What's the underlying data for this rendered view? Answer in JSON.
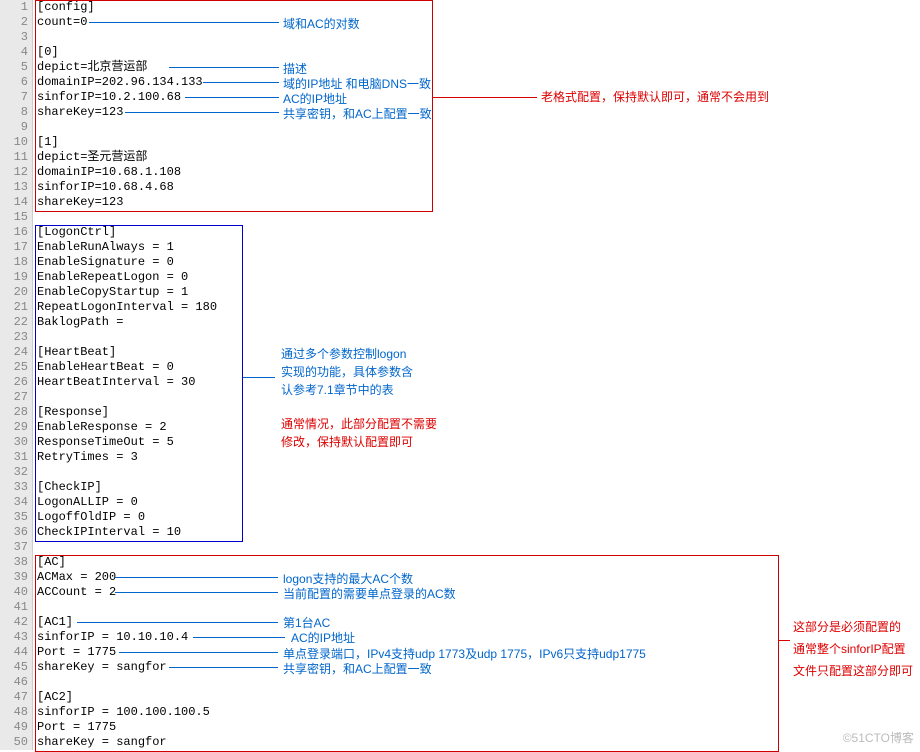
{
  "lines": [
    "[config]",
    "count=0",
    "",
    "[0]",
    "depict=北京营运部",
    "domainIP=202.96.134.133",
    "sinforIP=10.2.100.68",
    "shareKey=123",
    "",
    "[1]",
    "depict=圣元营运部",
    "domainIP=10.68.1.108",
    "sinforIP=10.68.4.68",
    "shareKey=123",
    "",
    "[LogonCtrl]",
    "EnableRunAlways = 1",
    "EnableSignature = 0",
    "EnableRepeatLogon = 0",
    "EnableCopyStartup = 1",
    "RepeatLogonInterval = 180",
    "BaklogPath =",
    "",
    "[HeartBeat]",
    "EnableHeartBeat = 0",
    "HeartBeatInterval = 30",
    "",
    "[Response]",
    "EnableResponse = 2",
    "ResponseTimeOut = 5",
    "RetryTimes = 3",
    "",
    "[CheckIP]",
    "LogonALLIP = 0",
    "LogoffOldIP = 0",
    "CheckIPInterval = 10",
    "",
    "[AC]",
    "ACMax = 200",
    "ACCount = 2",
    "",
    "[AC1]",
    "sinforIP = 10.10.10.4",
    "Port = 1775",
    "shareKey = sangfor",
    "",
    "[AC2]",
    "sinforIP = 100.100.100.5",
    "Port = 1775",
    "shareKey = sangfor"
  ],
  "annotations": {
    "a1": "域和AC的对数",
    "a2": "描述",
    "a3": "域的IP地址    和电脑DNS一致",
    "a4": "AC的IP地址",
    "a5": "共享密钥，和AC上配置一致",
    "r1": "老格式配置，保持默认即可，通常不会用到",
    "b1": "通过多个参数控制logon",
    "b2": "实现的功能，具体参数含",
    "b3": "认参考7.1章节中的表",
    "rb1": "通常情况，此部分配置不需要",
    "rb2": "修改，保持默认配置即可",
    "c1": "logon支持的最大AC个数",
    "c2": "当前配置的需要单点登录的AC数",
    "c3": "第1台AC",
    "c4": "AC的IP地址",
    "c5": "单点登录端口，IPv4支持udp 1773及udp 1775，IPv6只支持udp1775",
    "c6": "共享密钥，和AC上配置一致",
    "r2a": "这部分是必须配置的",
    "r2b": "通常整个sinforIP配置",
    "r2c": "文件只配置这部分即可"
  },
  "watermark": "©51CTO博客"
}
